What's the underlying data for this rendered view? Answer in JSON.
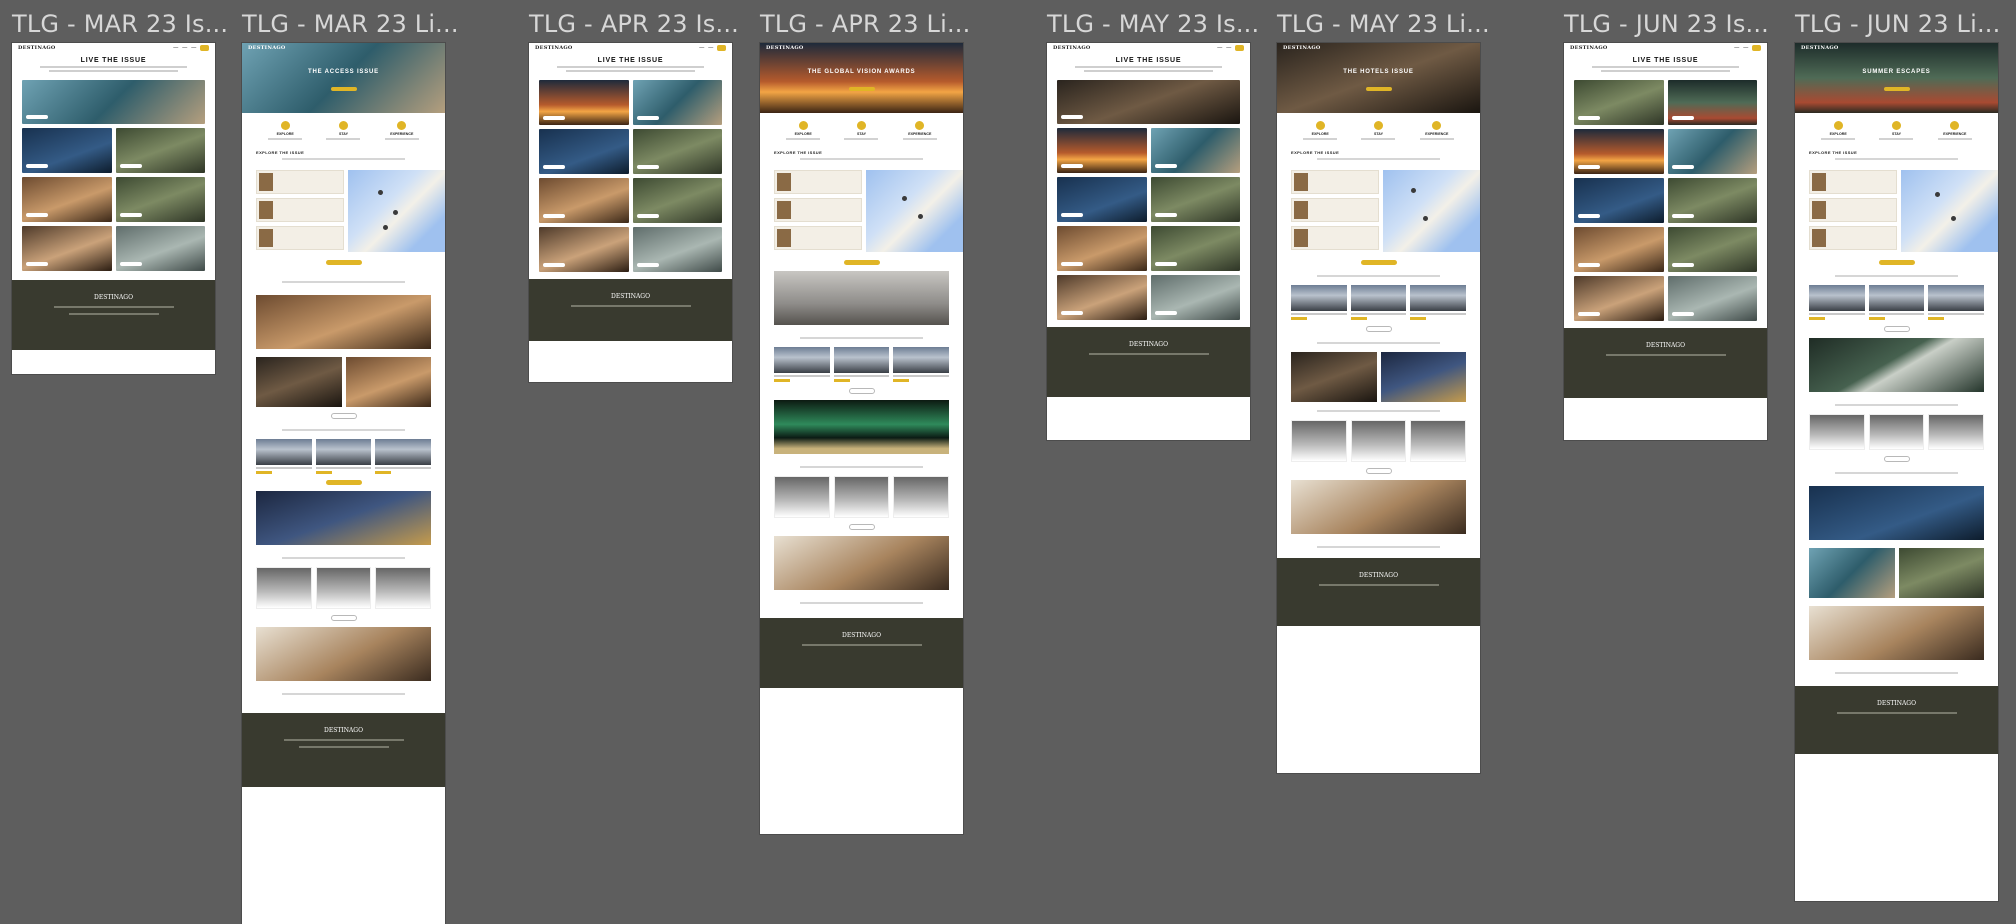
{
  "canvas_bg": "#5e5e5e",
  "accent": "#e0b526",
  "footer_bg": "#393a2f",
  "frames": [
    {
      "label": "TLG - MAR 23 Is..."
    },
    {
      "label": "TLG - MAR 23 Li..."
    },
    {
      "label": "TLG - APR 23 Is..."
    },
    {
      "label": "TLG - APR 23 Li..."
    },
    {
      "label": "TLG - MAY 23 Is..."
    },
    {
      "label": "TLG - MAY 23 Li..."
    },
    {
      "label": "TLG - JUN 23 Is..."
    },
    {
      "label": "TLG - JUN 23 Li..."
    }
  ],
  "issue_heading": "LIVE THE ISSUE",
  "hero_titles": {
    "mar": "THE ACCESS ISSUE",
    "apr": "THE GLOBAL VISION AWARDS",
    "may": "THE HOTELS ISSUE",
    "jun": "SUMMER ESCAPES"
  },
  "icon_labels": [
    "EXPLORE",
    "STAY",
    "EXPERIENCE"
  ],
  "section_explore": "EXPLORE THE ISSUE",
  "logo": "DESTINAGO"
}
